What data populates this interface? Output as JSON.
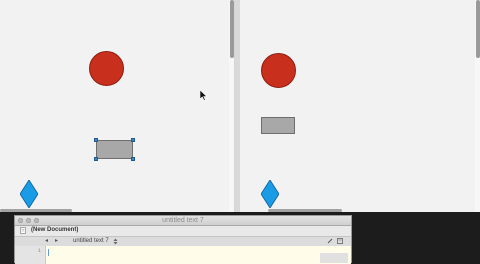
{
  "colors": {
    "canvas": "#f2f2f2",
    "circle_fill": "#c8301d",
    "rect_fill": "#a8a8a8",
    "diamond_fill": "#1a9be6",
    "selection_handle": "#3f86c9",
    "editor_background": "#fffce9"
  },
  "left_canvas": {
    "shapes": [
      "red-circle",
      "gray-rectangle-selected",
      "blue-diamond"
    ]
  },
  "right_canvas": {
    "shapes": [
      "red-circle",
      "gray-rectangle",
      "blue-diamond"
    ]
  },
  "editor": {
    "window_title": "untitled text 7",
    "document_label": "(New Document)",
    "file_selector": "untitled text 7",
    "nav_back": "◂",
    "nav_forward": "▸",
    "line_number": "1"
  }
}
